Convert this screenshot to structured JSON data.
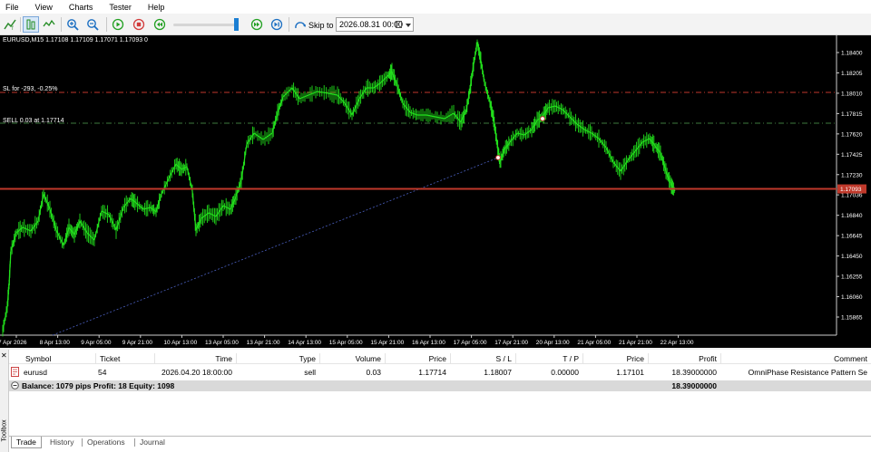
{
  "menu": [
    "File",
    "View",
    "Charts",
    "Tester",
    "Help"
  ],
  "toolbar": {
    "skip_label": "Skip to",
    "skip_date": "2026.08.31 00:00"
  },
  "chart": {
    "info": "EURUSD,M15  1.17108 1.17109 1.17071 1.17093  0",
    "sl_label": "SL for -293, -0.25%",
    "sell_label": "SELL 0.03 at 1.17714",
    "price_labels": [
      "1.18400",
      "1.18205",
      "1.18010",
      "1.17815",
      "1.17620",
      "1.17425",
      "1.17230",
      "1.17036",
      "1.16840",
      "1.16645",
      "1.16450",
      "1.16255",
      "1.16060",
      "1.15865"
    ],
    "current_price": "1.17093",
    "time_labels": [
      "7 Apr 2026",
      "8 Apr 13:00",
      "9 Apr 05:00",
      "9 Apr 21:00",
      "10 Apr 13:00",
      "13 Apr 05:00",
      "13 Apr 21:00",
      "14 Apr 13:00",
      "15 Apr 05:00",
      "15 Apr 21:00",
      "16 Apr 13:00",
      "17 Apr 05:00",
      "17 Apr 21:00",
      "20 Apr 13:00",
      "21 Apr 05:00",
      "21 Apr 21:00",
      "22 Apr 13:00"
    ],
    "colors": {
      "candles": "#22e01c",
      "sl_line": "#c0392b",
      "sell_line": "#3e7a3e",
      "price_line": "#c0392b",
      "trend_line": "#4a5fbf"
    }
  },
  "terminal": {
    "headers": [
      "Symbol",
      "Ticket",
      "Time",
      "Type",
      "Volume",
      "Price",
      "S / L",
      "T / P",
      "Price",
      "Profit",
      "Comment"
    ],
    "position": {
      "symbol": "eurusd",
      "ticket": "54",
      "time": "2026.04.20 18:00:00",
      "type": "sell",
      "volume": "0.03",
      "open_price": "1.17714",
      "sl": "1.18007",
      "tp": "0.00000",
      "price": "1.17101",
      "profit": "18.39000000",
      "comment": "OmniPhase Resistance Pattern Se"
    },
    "balance": "Balance: 1079 pips   Profit: 18   Equity: 1098",
    "total_profit": "18.39000000",
    "tabs": [
      "Trade",
      "History",
      "Operations",
      "Journal"
    ],
    "toolbox_label": "Toolbox"
  }
}
